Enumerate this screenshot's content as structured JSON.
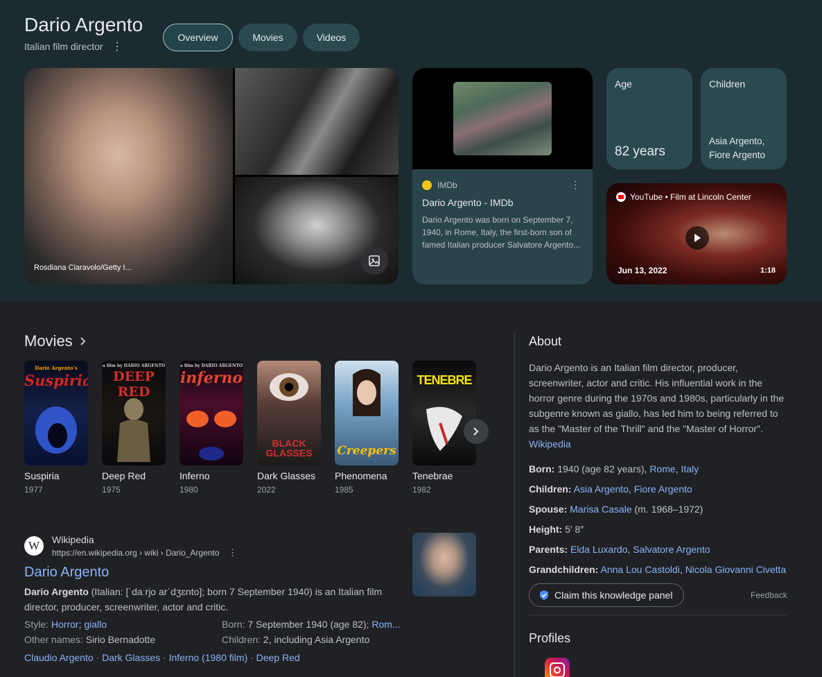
{
  "header": {
    "title": "Dario Argento",
    "subtitle": "Italian film director",
    "more_glyph": "⋮",
    "tabs": [
      {
        "label": "Overview",
        "active": true
      },
      {
        "label": "Movies",
        "active": false
      },
      {
        "label": "Videos",
        "active": false
      }
    ]
  },
  "gallery": {
    "credit": "Rosdiana Ciaravolo/Getty I..."
  },
  "imdb_card": {
    "source": "IMDb",
    "title": "Dario Argento - IMDb",
    "snippet": "Dario Argento was born on September 7, 1940, in Rome, Italy, the first-born son of famed Italian producer Salvatore Argento..."
  },
  "facts_tiles": {
    "age": {
      "label": "Age",
      "value": "82 years"
    },
    "children": {
      "label": "Children",
      "value": "Asia Argento, Fiore Argento"
    }
  },
  "youtube_card": {
    "source": "YouTube • Film at Lincoln Center",
    "date": "Jun 13, 2022",
    "duration": "1:18"
  },
  "movies": {
    "heading": "Movies",
    "items": [
      {
        "title": "Suspiria",
        "year": "1977",
        "poster_text": "Suspiria",
        "poster_top": "Dario Argento's",
        "color": "#c9231b"
      },
      {
        "title": "Deep Red",
        "year": "1975",
        "poster_text": "DEEP RED",
        "poster_top": "a film by DARIO ARGENTO",
        "color": "#c9231b"
      },
      {
        "title": "Inferno",
        "year": "1980",
        "poster_text": "inferno",
        "poster_top": "a film by DARIO ARGENTO",
        "color": "#d33a2c"
      },
      {
        "title": "Dark Glasses",
        "year": "2022",
        "poster_text": "BLACK GLASSES",
        "poster_top": "",
        "color": "#d32f2f"
      },
      {
        "title": "Phenomena",
        "year": "1985",
        "poster_text": "Creepers",
        "poster_top": "",
        "color": "#f4c20d"
      },
      {
        "title": "Tenebrae",
        "year": "1982",
        "poster_text": "TENEBRE",
        "poster_top": "",
        "color": "#f4e30d"
      }
    ]
  },
  "wikipedia": {
    "site": "Wikipedia",
    "url": "https://en.wikipedia.org › wiki › Dario_Argento",
    "title": "Dario Argento",
    "snippet_bold": "Dario Argento",
    "snippet_rest": " (Italian: [ˈdaːrjo arˈdʒɛnto]; born 7 September 1940) is an Italian film director, producer, screenwriter, actor and critic.",
    "style_label": "Style:",
    "style_links": [
      "Horror",
      "giallo"
    ],
    "other_names_label": "Other names:",
    "other_names_value": "Sirio Bernadotte",
    "born_label": "Born:",
    "born_value": "7 September 1940 (age 82);",
    "born_link": "Rom...",
    "children_label": "Children:",
    "children_value": "2, including Asia Argento",
    "related_links": [
      "Claudio Argento",
      "Dark Glasses",
      "Inferno (1980 film)",
      "Deep Red"
    ]
  },
  "about": {
    "heading": "About",
    "text": "Dario Argento is an Italian film director, producer, screenwriter, actor and critic. His influential work in the horror genre during the 1970s and 1980s, particularly in the subgenre known as giallo, has led him to being referred to as the \"Master of the Thrill\" and the \"Master of Horror\".",
    "source_link": "Wikipedia",
    "facts": [
      {
        "label": "Born:",
        "plain": " 1940 (age 82 years), ",
        "links": [
          "Rome",
          "Italy"
        ],
        "suffix": ""
      },
      {
        "label": "Children:",
        "plain": " ",
        "links": [
          "Asia Argento",
          "Fiore Argento"
        ],
        "suffix": ""
      },
      {
        "label": "Spouse:",
        "plain": " ",
        "links": [
          "Marisa Casale"
        ],
        "suffix": " (m. 1968–1972)"
      },
      {
        "label": "Height:",
        "plain": " 5′ 8″",
        "links": [],
        "suffix": ""
      },
      {
        "label": "Parents:",
        "plain": " ",
        "links": [
          "Elda Luxardo",
          "Salvatore Argento"
        ],
        "suffix": ""
      },
      {
        "label": "Grandchildren:",
        "plain": " ",
        "links": [
          "Anna Lou Castoldi",
          "Nicola Giovanni Civetta"
        ],
        "suffix": ""
      }
    ],
    "claim_label": "Claim this knowledge panel",
    "feedback_label": "Feedback",
    "profiles_heading": "Profiles"
  }
}
